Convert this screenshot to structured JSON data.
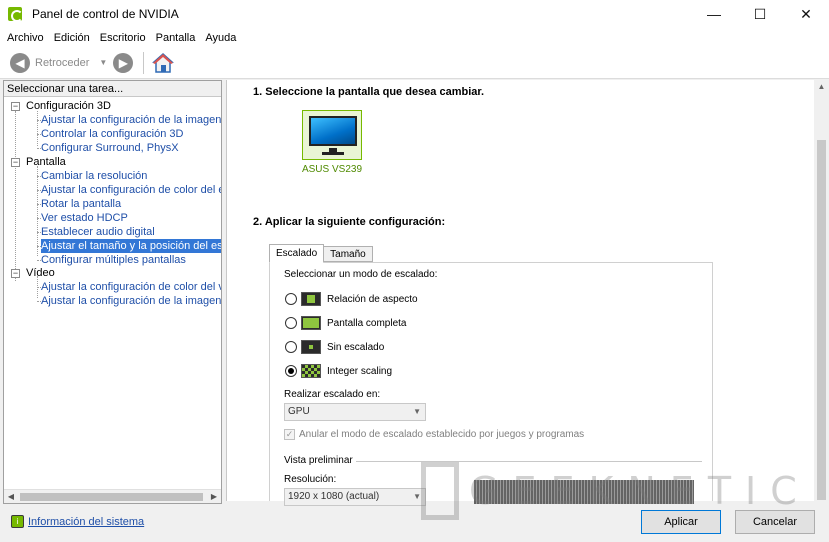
{
  "window": {
    "title": "Panel de control de NVIDIA",
    "controls": {
      "minimize": "—",
      "maximize": "☐",
      "close": "✕"
    }
  },
  "menu": [
    "Archivo",
    "Edición",
    "Escritorio",
    "Pantalla",
    "Ayuda"
  ],
  "toolbar": {
    "back_label": "Retroceder",
    "back_icon": "◀",
    "forward_icon": "▶",
    "dropdown_icon": "▼"
  },
  "sidebar": {
    "header": "Seleccionar una tarea...",
    "categories": [
      {
        "label": "Configuración 3D",
        "items": [
          "Ajustar la configuración de la imagen con v",
          "Controlar la configuración 3D",
          "Configurar Surround, PhysX"
        ]
      },
      {
        "label": "Pantalla",
        "items": [
          "Cambiar la resolución",
          "Ajustar la configuración de color del escrito",
          "Rotar la pantalla",
          "Ver estado HDCP",
          "Establecer audio digital",
          "Ajustar el tamaño y la posición del escritorio",
          "Configurar múltiples pantallas"
        ]
      },
      {
        "label": "Vídeo",
        "items": [
          "Ajustar la configuración de color del vídeo",
          "Ajustar la configuración de la imagen de víd"
        ]
      }
    ],
    "selected_item": "Ajustar el tamaño y la posición del escritorio",
    "system_info": "Información del sistema"
  },
  "main": {
    "step1_title": "1. Seleccione la pantalla que desea cambiar.",
    "display_name": "ASUS VS239",
    "step2_title": "2. Aplicar la siguiente configuración:",
    "tabs": [
      {
        "label": "Escalado",
        "active": true
      },
      {
        "label": "Tamaño",
        "active": false
      }
    ],
    "scaling_mode_label": "Seleccionar un modo de escalado:",
    "scaling_modes": [
      {
        "label": "Relación de aspecto",
        "selected": false
      },
      {
        "label": "Pantalla completa",
        "selected": false
      },
      {
        "label": "Sin escalado",
        "selected": false
      },
      {
        "label": "Integer scaling",
        "selected": true
      }
    ],
    "perform_on_label": "Realizar escalado en:",
    "perform_on_value": "GPU",
    "override_label": "Anular el modo de escalado establecido por juegos y programas",
    "override_checked": true,
    "preview_label": "Vista preliminar",
    "resolution_label": "Resolución:",
    "resolution_value": "1920 x 1080 (actual)"
  },
  "watermark": "GEEKNETIC",
  "buttons": {
    "apply": "Aplicar",
    "cancel": "Cancelar"
  },
  "colors": {
    "nvidia_green": "#76b900",
    "link_blue": "#1f4fa8",
    "selection": "#3377d6"
  }
}
